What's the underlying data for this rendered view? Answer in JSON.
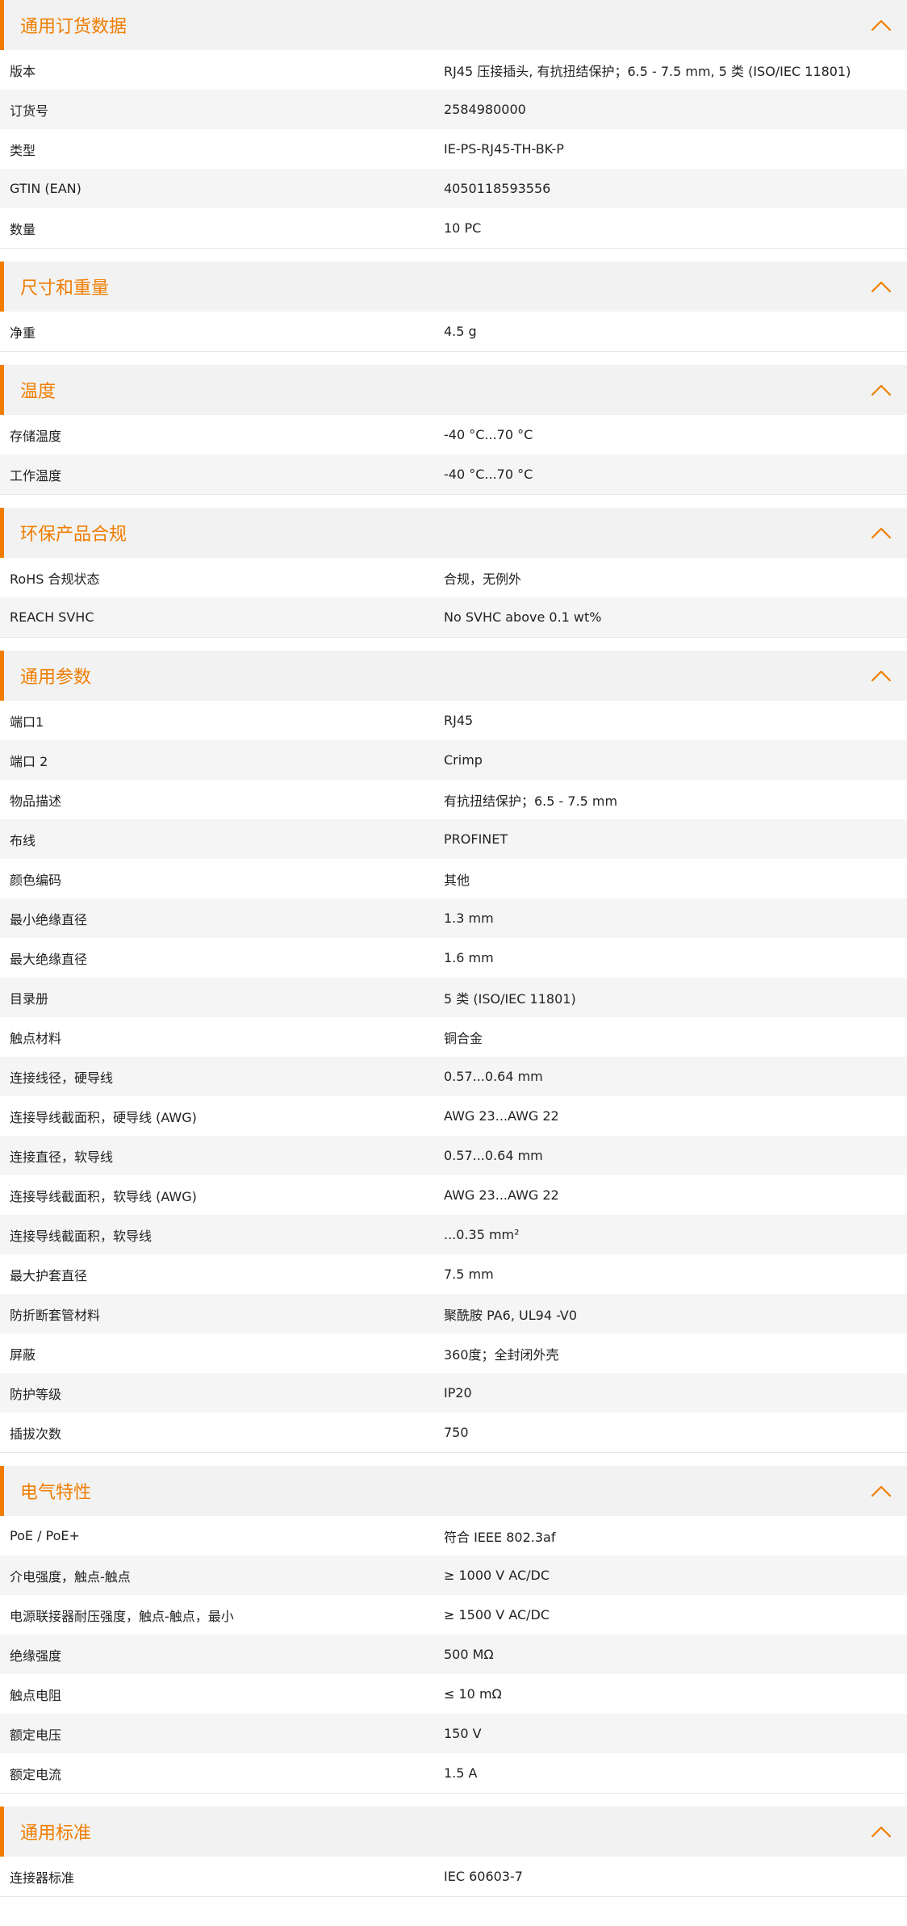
{
  "colors": {
    "accent": "#f07d00",
    "header_bg": "#f2f2f2",
    "row_alt_bg": "#f5f5f5"
  },
  "sections": [
    {
      "title": "通用订货数据",
      "icon": "chevron-up-icon",
      "rows": [
        {
          "label": "版本",
          "value": "RJ45 压接插头, 有抗扭结保护；6.5 - 7.5 mm, 5 类 (ISO/IEC 11801)"
        },
        {
          "label": "订货号",
          "value": "2584980000"
        },
        {
          "label": "类型",
          "value": "IE-PS-RJ45-TH-BK-P"
        },
        {
          "label": "GTIN (EAN)",
          "value": "4050118593556"
        },
        {
          "label": "数量",
          "value": "10  PC"
        }
      ]
    },
    {
      "title": "尺寸和重量",
      "icon": "chevron-up-icon",
      "rows": [
        {
          "label": "净重",
          "value": "4.5  g"
        }
      ]
    },
    {
      "title": "温度",
      "icon": "chevron-up-icon",
      "rows": [
        {
          "label": "存储温度",
          "value": "-40 °C...70 °C"
        },
        {
          "label": "工作温度",
          "value": "-40 °C...70 °C"
        }
      ]
    },
    {
      "title": "环保产品合规",
      "icon": "chevron-up-icon",
      "rows": [
        {
          "label": "RoHS 合规状态",
          "value": "合规，无例外"
        },
        {
          "label": "REACH SVHC",
          "value": "No SVHC above 0.1 wt%"
        }
      ]
    },
    {
      "title": "通用参数",
      "icon": "chevron-up-icon",
      "rows": [
        {
          "label": "端口1",
          "value": "RJ45"
        },
        {
          "label": "端口 2",
          "value": "Crimp"
        },
        {
          "label": "物品描述",
          "value": "有抗扭结保护；6.5 - 7.5 mm"
        },
        {
          "label": "布线",
          "value": "PROFINET"
        },
        {
          "label": "颜色编码",
          "value": "其他"
        },
        {
          "label": "最小绝缘直径",
          "value": "1.3  mm"
        },
        {
          "label": "最大绝缘直径",
          "value": "1.6  mm"
        },
        {
          "label": "目录册",
          "value": "5 类 (ISO/IEC 11801)"
        },
        {
          "label": "触点材料",
          "value": "铜合金"
        },
        {
          "label": "连接线径，硬导线",
          "value": "0.57...0.64 mm"
        },
        {
          "label": "连接导线截面积，硬导线 (AWG)",
          "value": "AWG 23...AWG 22"
        },
        {
          "label": "连接直径，软导线",
          "value": "0.57...0.64 mm"
        },
        {
          "label": "连接导线截面积，软导线 (AWG)",
          "value": "AWG 23...AWG 22"
        },
        {
          "label": "连接导线截面积，软导线",
          "value": "...0.35 mm²"
        },
        {
          "label": "最大护套直径",
          "value": "7.5  mm"
        },
        {
          "label": "防折断套管材料",
          "value": "聚酰胺 PA6, UL94 -V0"
        },
        {
          "label": "屏蔽",
          "value": "360度；全封闭外壳"
        },
        {
          "label": "防护等级",
          "value": "IP20"
        },
        {
          "label": "插拔次数",
          "value": "750"
        }
      ]
    },
    {
      "title": "电气特性",
      "icon": "chevron-up-icon",
      "rows": [
        {
          "label": "PoE / PoE+",
          "value": "符合 IEEE 802.3af"
        },
        {
          "label": "介电强度，触点-触点",
          "value": "≥ 1000 V AC/DC"
        },
        {
          "label": "电源联接器耐压强度，触点-触点，最小",
          "value": "≥ 1500 V AC/DC"
        },
        {
          "label": "绝缘强度",
          "value": "500 MΩ"
        },
        {
          "label": "触点电阻",
          "value": "≤ 10 mΩ"
        },
        {
          "label": "额定电压",
          "value": "150  V"
        },
        {
          "label": "额定电流",
          "value": "1.5 A"
        }
      ]
    },
    {
      "title": "通用标准",
      "icon": "chevron-up-icon",
      "rows": [
        {
          "label": "连接器标准",
          "value": "IEC 60603-7"
        }
      ]
    }
  ]
}
